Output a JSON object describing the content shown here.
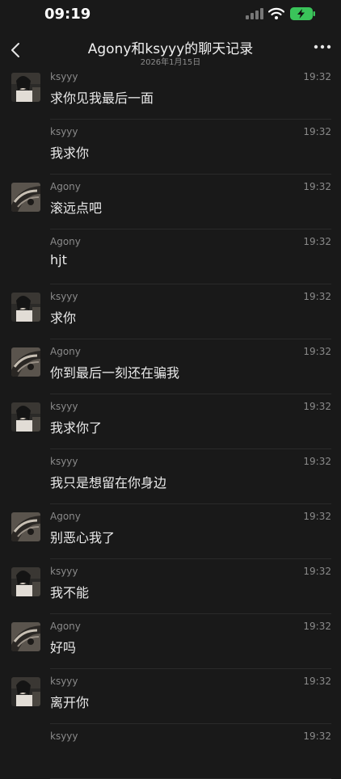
{
  "status": {
    "time": "09:19"
  },
  "header": {
    "title": "Agony和ksyyy的聊天记录",
    "subtitle": "2026年1月15日"
  },
  "messages": [
    {
      "sender": "ksyyy",
      "time": "19:32",
      "text": "求你见我最后一面",
      "avatar": "ksyyy-avatar"
    },
    {
      "sender": "ksyyy",
      "time": "19:32",
      "text": "我求你",
      "avatar": ""
    },
    {
      "sender": "Agony",
      "time": "19:32",
      "text": "滚远点吧",
      "avatar": "agony-avatar"
    },
    {
      "sender": "Agony",
      "time": "19:32",
      "text": "hjt",
      "avatar": ""
    },
    {
      "sender": "ksyyy",
      "time": "19:32",
      "text": "求你",
      "avatar": "ksyyy-avatar"
    },
    {
      "sender": "Agony",
      "time": "19:32",
      "text": "你到最后一刻还在骗我",
      "avatar": "agony-avatar"
    },
    {
      "sender": "ksyyy",
      "time": "19:32",
      "text": "我求你了",
      "avatar": "ksyyy-avatar"
    },
    {
      "sender": "ksyyy",
      "time": "19:32",
      "text": "我只是想留在你身边",
      "avatar": ""
    },
    {
      "sender": "Agony",
      "time": "19:32",
      "text": "别恶心我了",
      "avatar": "agony-avatar"
    },
    {
      "sender": "ksyyy",
      "time": "19:32",
      "text": "我不能",
      "avatar": "ksyyy-avatar"
    },
    {
      "sender": "Agony",
      "time": "19:32",
      "text": "好吗",
      "avatar": "agony-avatar"
    },
    {
      "sender": "ksyyy",
      "time": "19:32",
      "text": "离开你",
      "avatar": "ksyyy-avatar"
    },
    {
      "sender": "ksyyy",
      "time": "19:32",
      "text": "",
      "avatar": ""
    }
  ]
}
